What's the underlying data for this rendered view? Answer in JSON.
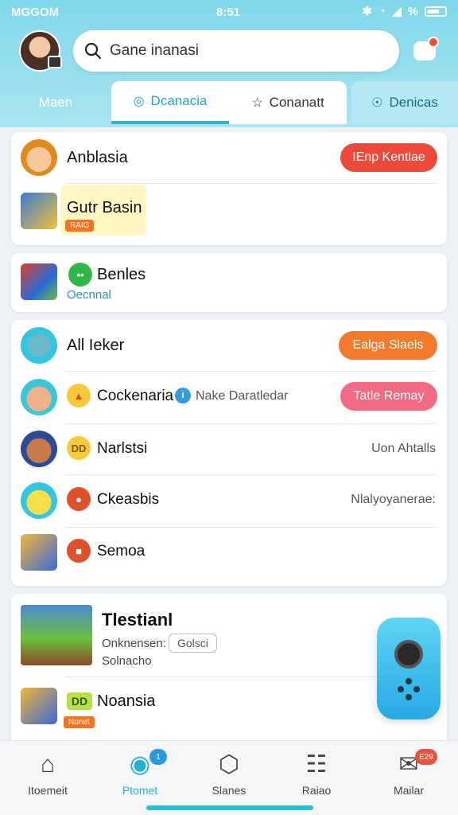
{
  "status": {
    "carrier": "MGGOM",
    "time": "8:51",
    "battery_icon": "battery-icon",
    "wifi_icon": "wifi-icon",
    "signal": "%"
  },
  "search": {
    "value": "Gane inanasi"
  },
  "tabs": [
    {
      "label": "Maen",
      "icon": ""
    },
    {
      "label": "Dcanacia",
      "icon": "shield-icon"
    },
    {
      "label": "Conanatt",
      "icon": "star-icon"
    },
    {
      "label": "Denicas",
      "icon": "chat-icon"
    }
  ],
  "card1": {
    "rows": [
      {
        "title": "Anblasia",
        "button": "IEnp Kentlae"
      },
      {
        "title": "Gutr Basin",
        "tag": "RAIG"
      }
    ]
  },
  "card2": {
    "title": "Benles",
    "sub": "Oecnnal"
  },
  "card3": {
    "rows": [
      {
        "title": "All  Ieker",
        "button": "Ealga Slaels"
      },
      {
        "title": "Cockenaria",
        "badge_text": "Nake Daratledar",
        "button": "Tatle Remay"
      },
      {
        "title": "Narlstsi",
        "circ": "DD",
        "meta": "Uon Ahtalls"
      },
      {
        "title": "Ckeasbis",
        "meta": "Nlalyoyanerae:"
      },
      {
        "title": "Semoa"
      }
    ]
  },
  "card4": {
    "title": "Tlestianl",
    "line1": "Onknensen:",
    "chip": "Golsci",
    "line2": "Solnacho",
    "row2_title": "Noansia",
    "row2_circ": "DD",
    "row2_tag": "Nonet"
  },
  "nav": [
    {
      "label": "Itoemeit",
      "icon": "home-icon"
    },
    {
      "label": "Ptomet",
      "icon": "game-icon",
      "badge": "1"
    },
    {
      "label": "Slanes",
      "icon": "hexagon-icon"
    },
    {
      "label": "Raiao",
      "icon": "document-icon"
    },
    {
      "label": "Mailar",
      "icon": "chat-icon",
      "badge": "E29"
    }
  ],
  "colors": {
    "accent": "#2bb5d8",
    "red_button": "#ee4a3a",
    "orange_button": "#f27a2a",
    "pink_button": "#f36a84"
  }
}
